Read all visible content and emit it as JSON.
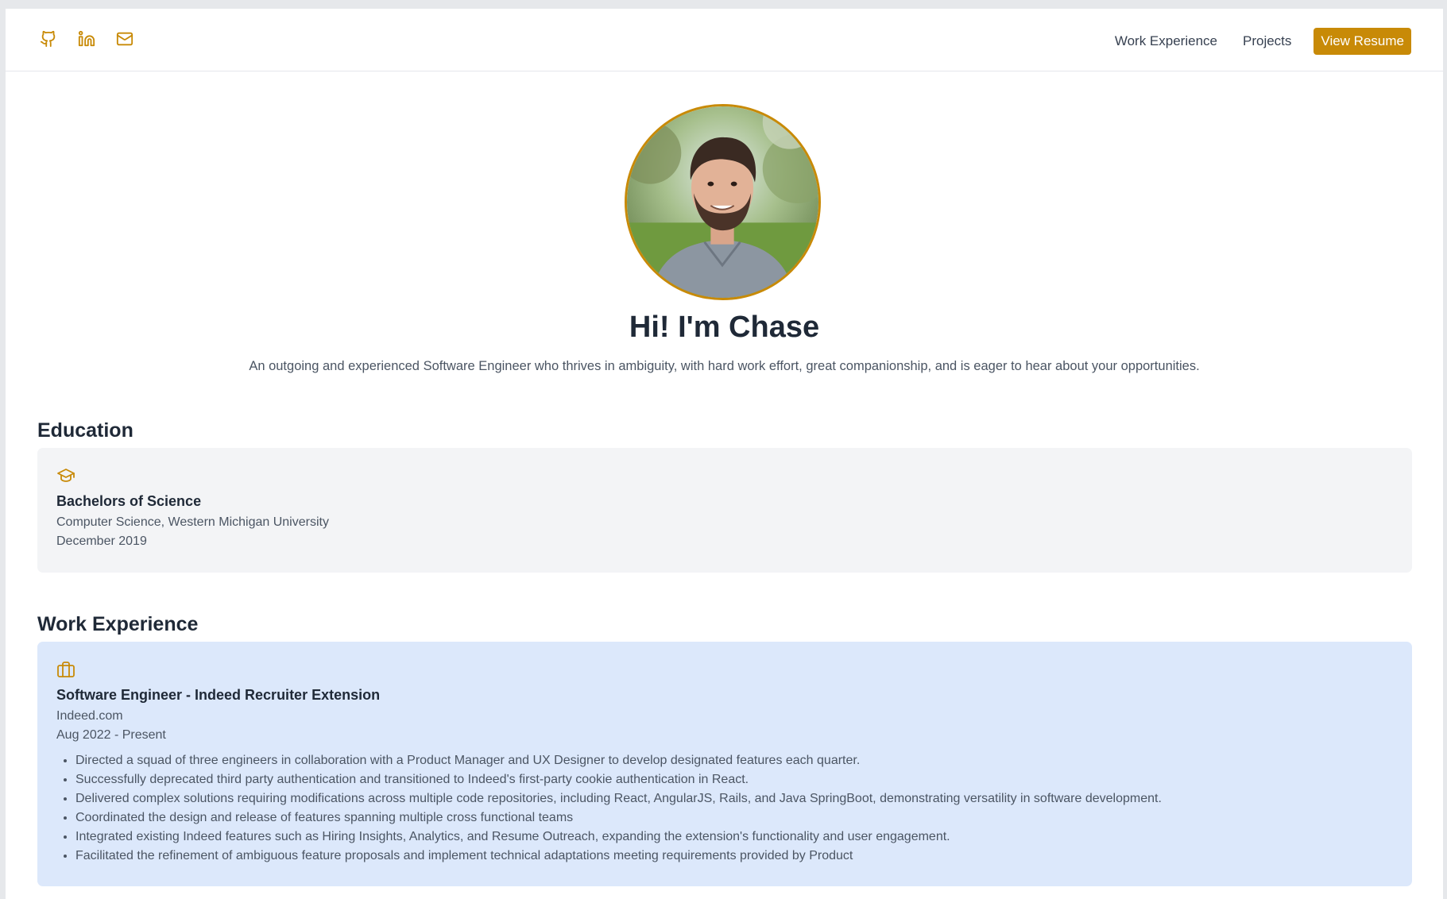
{
  "header": {
    "social": [
      {
        "icon": "github-icon",
        "label": "GitHub"
      },
      {
        "icon": "linkedin-icon",
        "label": "LinkedIn"
      },
      {
        "icon": "mail-icon",
        "label": "Email"
      }
    ],
    "nav": {
      "work_experience": "Work Experience",
      "projects": "Projects",
      "resume_button": "View Resume"
    }
  },
  "hero": {
    "title": "Hi! I'm Chase",
    "subtitle": "An outgoing and experienced Software Engineer who thrives in ambiguity, with hard work effort, great companionship, and is eager to hear about your opportunities."
  },
  "education": {
    "heading": "Education",
    "items": [
      {
        "icon": "graduation-cap-icon",
        "title": "Bachelors of Science",
        "detail": "Computer Science, Western Michigan University",
        "date": "December 2019"
      }
    ]
  },
  "work": {
    "heading": "Work Experience",
    "items": [
      {
        "icon": "briefcase-icon",
        "title": "Software Engineer - Indeed Recruiter Extension",
        "company": "Indeed.com",
        "dates": "Aug 2022 - Present",
        "bullets": [
          "Directed a squad of three engineers in collaboration with a Product Manager and UX Designer to develop designated features each quarter.",
          "Successfully deprecated third party authentication and transitioned to Indeed's first-party cookie authentication in React.",
          "Delivered complex solutions requiring modifications across multiple code repositories, including React, AngularJS, Rails, and Java SpringBoot, demonstrating versatility in software development.",
          "Coordinated the design and release of features spanning multiple cross functional teams",
          "Integrated existing Indeed features such as Hiring Insights, Analytics, and Resume Outreach, expanding the extension's functionality and user engagement.",
          "Facilitated the refinement of ambiguous feature proposals and implement technical adaptations meeting requirements provided by Product"
        ]
      }
    ]
  },
  "colors": {
    "accent": "#c88a07",
    "text_dark": "#1f2937",
    "text_muted": "#4b5563",
    "education_card_bg": "#f3f4f6",
    "work_card_bg": "#dce8fb"
  }
}
